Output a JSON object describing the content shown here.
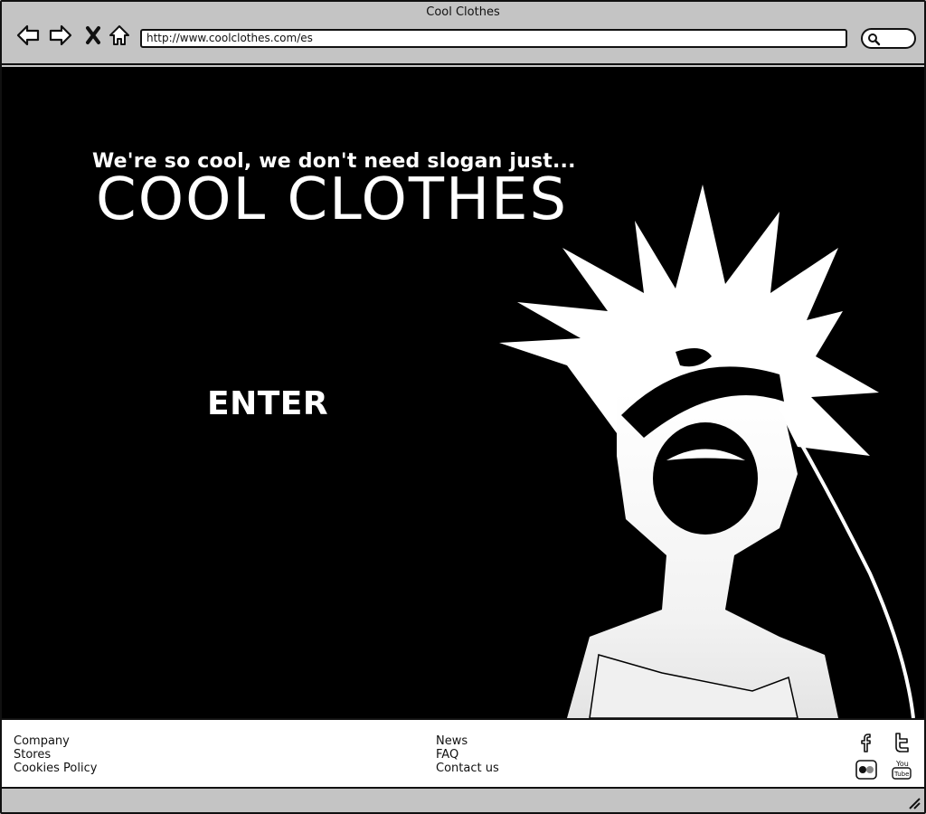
{
  "window": {
    "title": "Cool Clothes"
  },
  "browser": {
    "url": "http://www.coolclothes.com/es",
    "icons": [
      "back-arrow-icon",
      "forward-arrow-icon",
      "stop-icon",
      "home-icon",
      "search-icon"
    ]
  },
  "hero": {
    "slogan": "We're so cool, we don't need slogan just...",
    "brand": "COOL CLOTHES",
    "enter_label": "ENTER",
    "illustration": "spiky-haired-character-with-goggles"
  },
  "footer": {
    "left_links": [
      "Company",
      "Stores",
      "Cookies Policy"
    ],
    "middle_links": [
      "News",
      "FAQ",
      "Contact us"
    ],
    "social_icons": [
      "facebook-icon",
      "twitter-icon",
      "flickr-icon",
      "youtube-icon"
    ]
  },
  "colors": {
    "content_bg": "#000000",
    "chrome_bg": "#c4c4c4",
    "text_light": "#ffffff"
  }
}
